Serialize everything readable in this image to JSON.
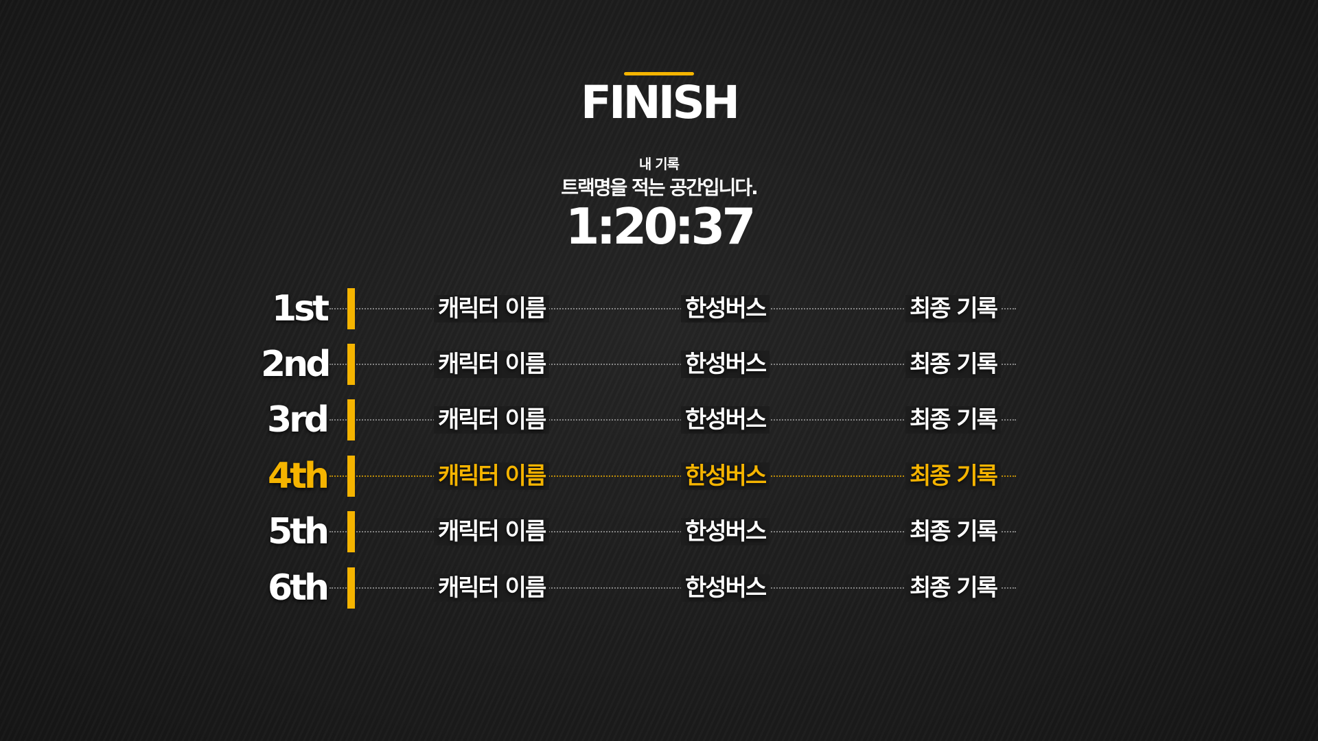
{
  "screen": {
    "title": "FINISH",
    "my_record_label": "내 기록",
    "track_name": "트랙명을 적는 공간입니다.",
    "my_time": "1:20:37"
  },
  "colors": {
    "accent": "#f5b400",
    "background": "#1c1c1c",
    "text": "#ffffff"
  },
  "ranking": [
    {
      "place": "1st",
      "character": "캐릭터 이름",
      "vehicle": "한성버스",
      "record": "최종 기록",
      "highlight": false
    },
    {
      "place": "2nd",
      "character": "캐릭터 이름",
      "vehicle": "한성버스",
      "record": "최종 기록",
      "highlight": false
    },
    {
      "place": "3rd",
      "character": "캐릭터 이름",
      "vehicle": "한성버스",
      "record": "최종 기록",
      "highlight": false
    },
    {
      "place": "4th",
      "character": "캐릭터 이름",
      "vehicle": "한성버스",
      "record": "최종 기록",
      "highlight": true
    },
    {
      "place": "5th",
      "character": "캐릭터 이름",
      "vehicle": "한성버스",
      "record": "최종 기록",
      "highlight": false
    },
    {
      "place": "6th",
      "character": "캐릭터 이름",
      "vehicle": "한성버스",
      "record": "최종 기록",
      "highlight": false
    }
  ]
}
